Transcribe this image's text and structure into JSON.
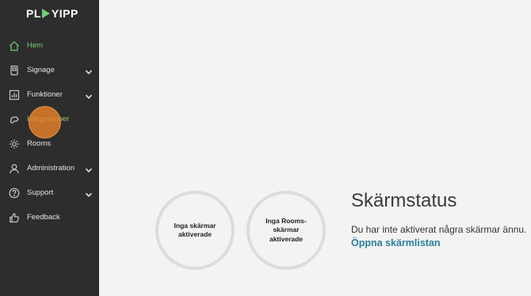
{
  "brand": {
    "logo_left": "PL",
    "logo_right": "YIPP"
  },
  "sidebar": {
    "items": [
      {
        "label": "Hem",
        "icon": "home-icon",
        "active": true,
        "has_submenu": false
      },
      {
        "label": "Signage",
        "icon": "tablet-icon",
        "active": false,
        "has_submenu": true
      },
      {
        "label": "Funktioner",
        "icon": "chart-icon",
        "active": false,
        "has_submenu": true
      },
      {
        "label": "Integrationer",
        "icon": "plug-icon",
        "active": false,
        "has_submenu": false
      },
      {
        "label": "Rooms",
        "icon": "gear-icon",
        "active": false,
        "has_submenu": false
      },
      {
        "label": "Administration",
        "icon": "user-icon",
        "active": false,
        "has_submenu": true
      },
      {
        "label": "Support",
        "icon": "help-icon",
        "active": false,
        "has_submenu": true
      },
      {
        "label": "Feedback",
        "icon": "thumbs-up-icon",
        "active": false,
        "has_submenu": false
      }
    ]
  },
  "main": {
    "circles": [
      {
        "text": "Inga skärmar aktiverade"
      },
      {
        "text": "Inga Rooms-skärmar aktiverade"
      }
    ],
    "title": "Skärmstatus",
    "description": "Du har inte aktiverat några skärmar ännu.",
    "link": "Öppna skärmlistan"
  },
  "colors": {
    "sidebar_bg": "#2d2d2d",
    "accent_green": "#6fcf73",
    "link_blue": "#2a7f9e",
    "cursor_orange": "#e88028"
  }
}
